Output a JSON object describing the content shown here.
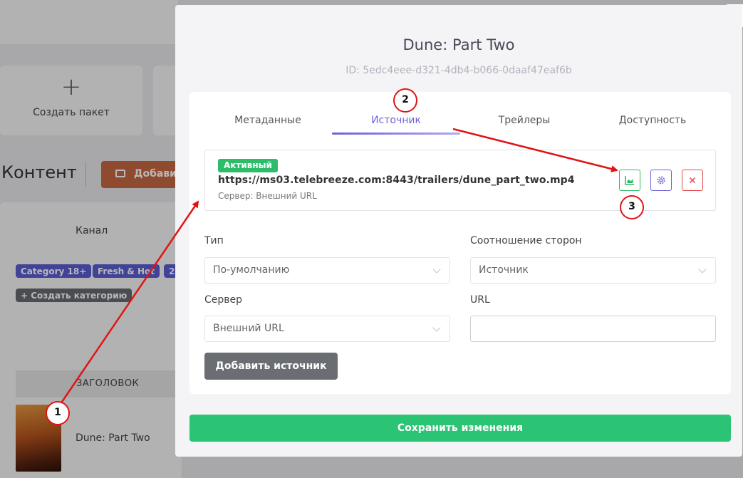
{
  "background": {
    "tile_plus": "+",
    "tile_label": "Создать пакет",
    "content_title": "Контент",
    "add_button": "Добави",
    "channel_label": "Канал",
    "chips": [
      "Category 18+",
      "Fresh & Hot",
      "2"
    ],
    "create_category": "+ Создать категорию",
    "table_header": "ЗАГОЛОВОК",
    "row_title": "Dune: Part Two",
    "close_icon": "×"
  },
  "modal": {
    "title": "Dune: Part Two",
    "id_label": "ID:",
    "id_value": "5edc4eee-d321-4db4-b066-0daaf47eaf6b",
    "tabs": [
      {
        "label": "Метаданные",
        "active": false
      },
      {
        "label": "Источник",
        "active": true
      },
      {
        "label": "Трейлеры",
        "active": false
      },
      {
        "label": "Доступность",
        "active": false
      }
    ],
    "source": {
      "status": "Активный",
      "url": "https://ms03.telebreeze.com:8443/trailers/dune_part_two.mp4",
      "server": "Сервер: Внешний URL",
      "actions": [
        "stats-icon",
        "settings-icon",
        "delete-icon"
      ]
    },
    "form": {
      "type_label": "Тип",
      "type_value": "По-умолчанию",
      "aspect_label": "Соотношение сторон",
      "aspect_value": "Источник",
      "server_label": "Сервер",
      "server_value": "Внешний URL",
      "url_label": "URL",
      "url_value": ""
    },
    "add_source_button": "Добавить источник",
    "save_button": "Сохранить изменения"
  },
  "annotations": {
    "steps": [
      "1",
      "2",
      "3"
    ],
    "color": "#e01414"
  },
  "colors": {
    "accent": "#6c63d8",
    "success": "#2bc474",
    "danger": "#e04848"
  }
}
